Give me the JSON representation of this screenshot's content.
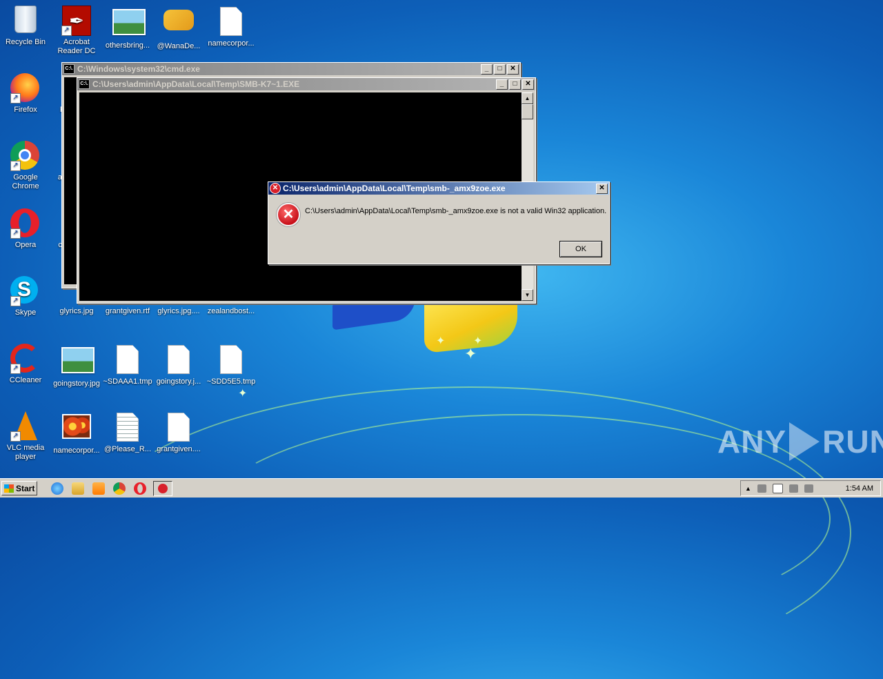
{
  "desktop": {
    "icons": [
      {
        "label": "Recycle Bin"
      },
      {
        "label": "Acrobat Reader DC"
      },
      {
        "label": "othersbring..."
      },
      {
        "label": "@WanaDe..."
      },
      {
        "label": "namecorpor..."
      },
      {
        "label": "Firefox"
      },
      {
        "label": "Fi"
      },
      {
        "label": "Google Chrome"
      },
      {
        "label": "ag"
      },
      {
        "label": "Opera"
      },
      {
        "label": "ch"
      },
      {
        "label": "Skype"
      },
      {
        "label": "glyrics.jpg"
      },
      {
        "label": "grantgiven.rtf"
      },
      {
        "label": "glyrics.jpg...."
      },
      {
        "label": "zealandbost..."
      },
      {
        "label": "CCleaner"
      },
      {
        "label": "goingstory.jpg"
      },
      {
        "label": "~SDAAA1.tmp"
      },
      {
        "label": "goingstory.j..."
      },
      {
        "label": "~SDD5E5.tmp"
      },
      {
        "label": "VLC media player"
      },
      {
        "label": "namecorpor..."
      },
      {
        "label": "@Please_R..."
      },
      {
        "label": "grantgiven...."
      }
    ]
  },
  "cmd_window": {
    "title": "C:\\Windows\\system32\\cmd.exe",
    "icon_text": "C:\\."
  },
  "smb_window": {
    "title": "C:\\Users\\admin\\AppData\\Local\\Temp\\SMB-K7~1.EXE",
    "icon_text": "C:\\."
  },
  "window_buttons": {
    "minimize": "_",
    "maximize": "□",
    "close": "✕"
  },
  "scroll_arrows": {
    "up": "▲",
    "down": "▼"
  },
  "error_dialog": {
    "title": "C:\\Users\\admin\\AppData\\Local\\Temp\\smb-_amx9zoe.exe",
    "message": "C:\\Users\\admin\\AppData\\Local\\Temp\\smb-_amx9zoe.exe is not a valid Win32 application.",
    "ok_label": "OK",
    "close_label": "✕",
    "error_glyph": "✕"
  },
  "taskbar": {
    "start_label": "Start",
    "clock": "1:54 AM",
    "tray_arrow": "▲"
  },
  "watermark": {
    "left": "ANY",
    "right": "RUN"
  },
  "colors": {
    "active_title": "#0a246a",
    "inactive_title": "#808080",
    "error_red": "#d8202a"
  }
}
